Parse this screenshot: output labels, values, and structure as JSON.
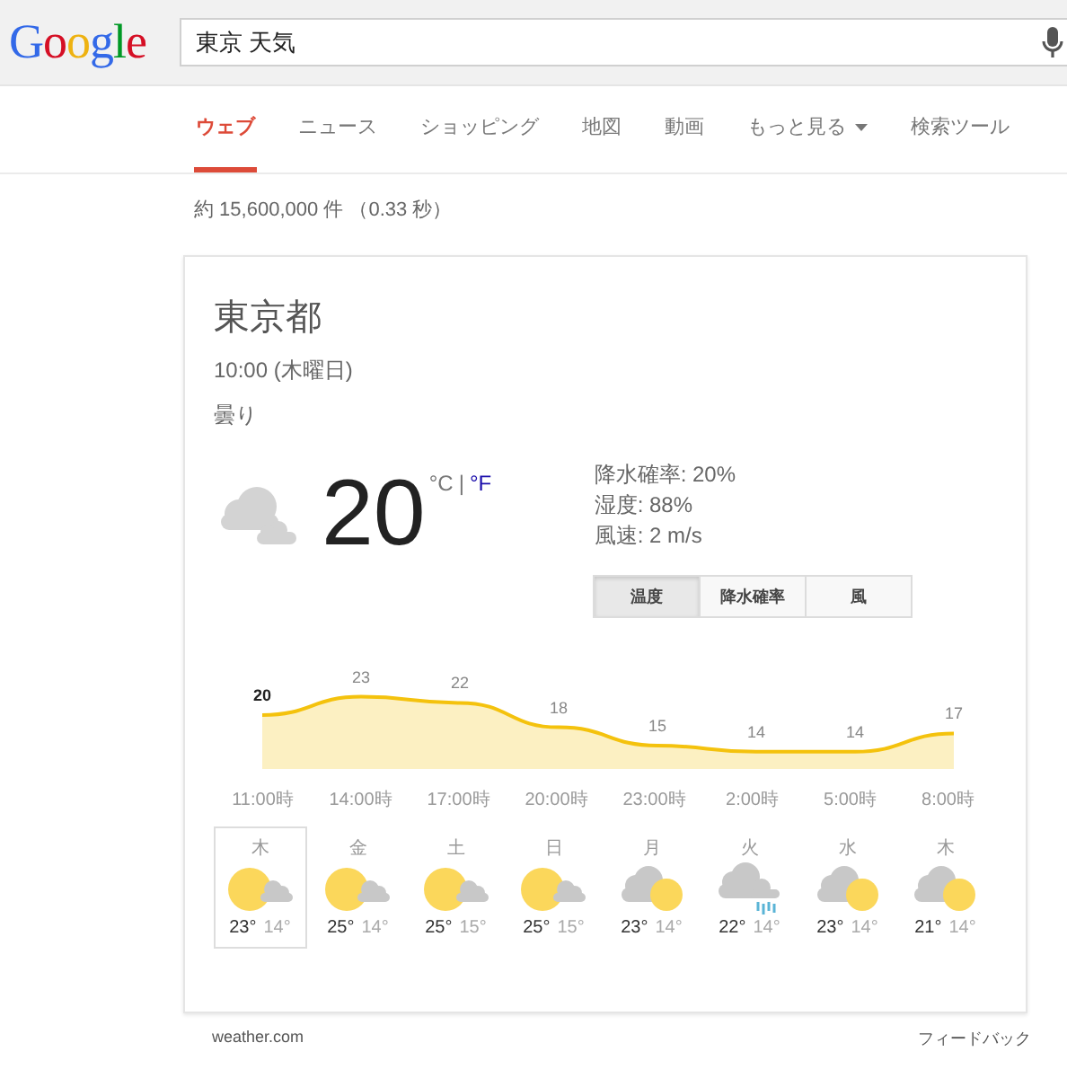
{
  "header": {
    "logo": "Google",
    "search": {
      "value": "東京 天気"
    }
  },
  "tabs": [
    {
      "label": "ウェブ",
      "selected": true
    },
    {
      "label": "ニュース",
      "selected": false
    },
    {
      "label": "ショッピング",
      "selected": false
    },
    {
      "label": "地図",
      "selected": false
    },
    {
      "label": "動画",
      "selected": false
    },
    {
      "label": "もっと見る",
      "selected": false,
      "dropdown": true
    },
    {
      "label": "検索ツール",
      "selected": false
    }
  ],
  "result_stats": "約 15,600,000 件 （0.33 秒）",
  "weather": {
    "location": "東京都",
    "time": "10:00 (木曜日)",
    "condition": "曇り",
    "temperature": "20",
    "units": [
      {
        "label": "°C",
        "selected": true
      },
      {
        "label": "°F",
        "selected": false
      }
    ],
    "unit_separator": "|",
    "details": [
      "降水確率: 20%",
      "湿度: 88%",
      "風速: 2 m/s"
    ],
    "chart_tabs": [
      {
        "label": "温度",
        "selected": true
      },
      {
        "label": "降水確率",
        "selected": false
      },
      {
        "label": "風",
        "selected": false
      }
    ],
    "chart_data": {
      "type": "area",
      "categories": [
        "11:00時",
        "14:00時",
        "17:00時",
        "20:00時",
        "23:00時",
        "2:00時",
        "5:00時",
        "8:00時"
      ],
      "values": [
        20,
        23,
        22,
        18,
        15,
        14,
        14,
        17
      ],
      "data_labels": true
    },
    "forecast": [
      {
        "day": "木",
        "kind": "sun_cloud",
        "high": "23°",
        "low": "14°",
        "selected": true
      },
      {
        "day": "金",
        "kind": "sun_cloud",
        "high": "25°",
        "low": "14°",
        "selected": false
      },
      {
        "day": "土",
        "kind": "sun_cloud",
        "high": "25°",
        "low": "15°",
        "selected": false
      },
      {
        "day": "日",
        "kind": "sun_cloud",
        "high": "25°",
        "low": "15°",
        "selected": false
      },
      {
        "day": "月",
        "kind": "cloud_sun",
        "high": "23°",
        "low": "14°",
        "selected": false
      },
      {
        "day": "火",
        "kind": "rain",
        "high": "22°",
        "low": "14°",
        "selected": false
      },
      {
        "day": "水",
        "kind": "cloud_sun",
        "high": "23°",
        "low": "14°",
        "selected": false
      },
      {
        "day": "木",
        "kind": "cloud_sun",
        "high": "21°",
        "low": "14°",
        "selected": false
      }
    ]
  },
  "footer": {
    "source": "weather.com",
    "feedback": "フィードバック"
  }
}
